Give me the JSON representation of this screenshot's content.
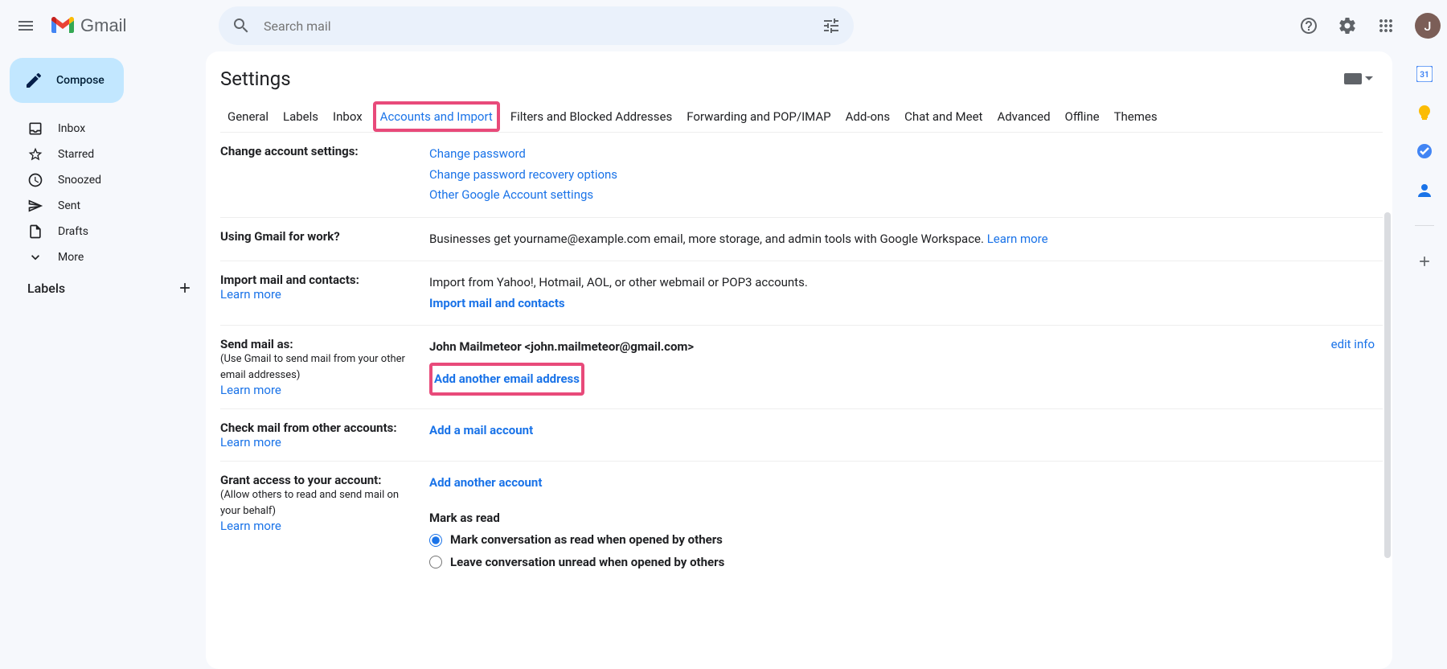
{
  "header": {
    "brand": "Gmail",
    "search_placeholder": "Search mail",
    "avatar_initial": "J"
  },
  "sidebar": {
    "compose": "Compose",
    "items": [
      {
        "label": "Inbox"
      },
      {
        "label": "Starred"
      },
      {
        "label": "Snoozed"
      },
      {
        "label": "Sent"
      },
      {
        "label": "Drafts"
      },
      {
        "label": "More"
      }
    ],
    "labels_header": "Labels"
  },
  "settings": {
    "title": "Settings",
    "tabs": [
      "General",
      "Labels",
      "Inbox",
      "Accounts and Import",
      "Filters and Blocked Addresses",
      "Forwarding and POP/IMAP",
      "Add-ons",
      "Chat and Meet",
      "Advanced",
      "Offline",
      "Themes"
    ],
    "rows": {
      "change_account": {
        "heading": "Change account settings:",
        "links": [
          "Change password",
          "Change password recovery options",
          "Other Google Account settings"
        ]
      },
      "work": {
        "heading": "Using Gmail for work?",
        "text": "Businesses get yourname@example.com email, more storage, and admin tools with Google Workspace. ",
        "learn": "Learn more"
      },
      "import": {
        "heading": "Import mail and contacts:",
        "learn": "Learn more",
        "text": "Import from Yahoo!, Hotmail, AOL, or other webmail or POP3 accounts.",
        "action": "Import mail and contacts"
      },
      "sendas": {
        "heading": "Send mail as:",
        "sub": "(Use Gmail to send mail from your other email addresses)",
        "learn": "Learn more",
        "identity": "John Mailmeteor <john.mailmeteor@gmail.com>",
        "action": "Add another email address",
        "edit": "edit info"
      },
      "checkmail": {
        "heading": "Check mail from other accounts:",
        "learn": "Learn more",
        "action": "Add a mail account"
      },
      "grant": {
        "heading": "Grant access to your account:",
        "sub": "(Allow others to read and send mail on your behalf)",
        "learn": "Learn more",
        "action": "Add another account",
        "mark_heading": "Mark as read",
        "opt1": "Mark conversation as read when opened by others",
        "opt2": "Leave conversation unread when opened by others"
      }
    }
  }
}
